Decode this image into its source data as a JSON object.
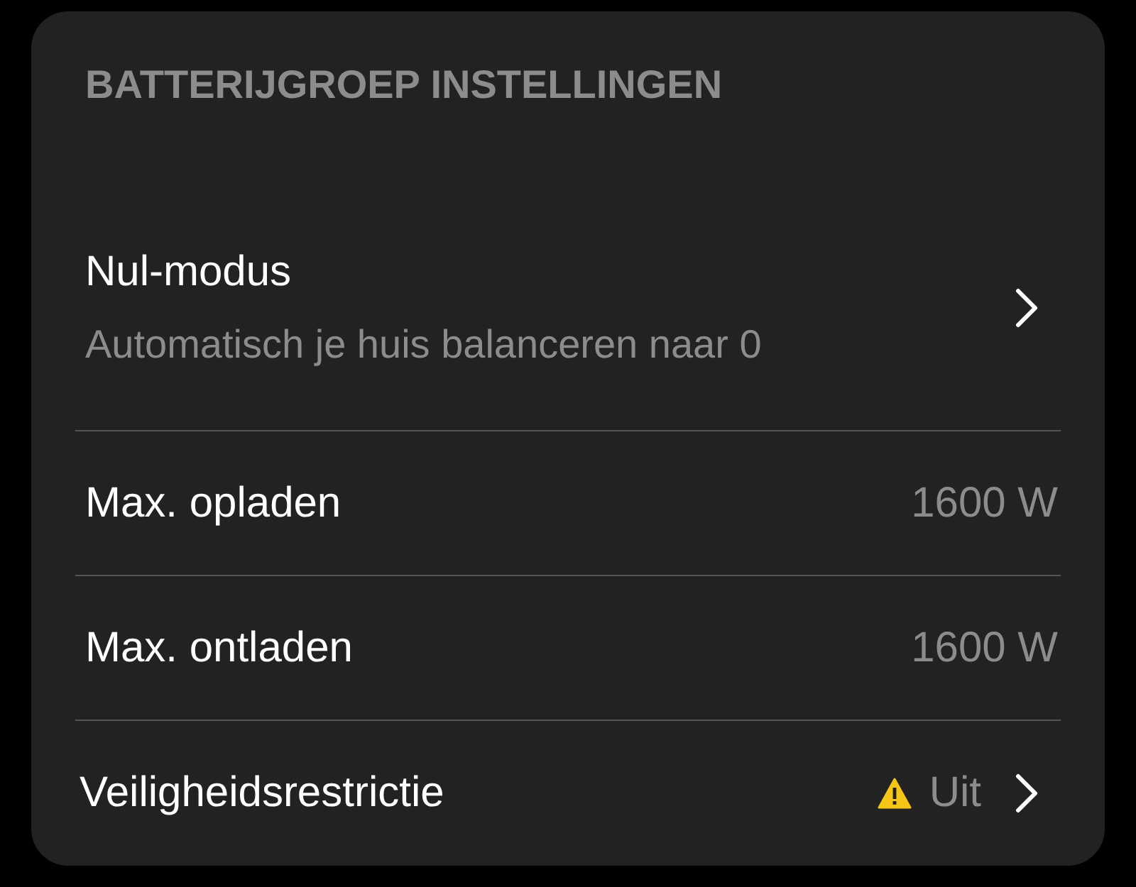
{
  "section_title": "BATTERIJGROEP INSTELLINGEN",
  "rows": [
    {
      "kind": "nav",
      "label": "Nul-modus",
      "description": "Automatisch je huis balanceren naar 0"
    },
    {
      "kind": "value",
      "label": "Max. opladen",
      "value": "1600 W"
    },
    {
      "kind": "value",
      "label": "Max. ontladen",
      "value": "1600 W"
    },
    {
      "kind": "warning",
      "label": "Veiligheidsrestrictie",
      "value": "Uit"
    }
  ]
}
